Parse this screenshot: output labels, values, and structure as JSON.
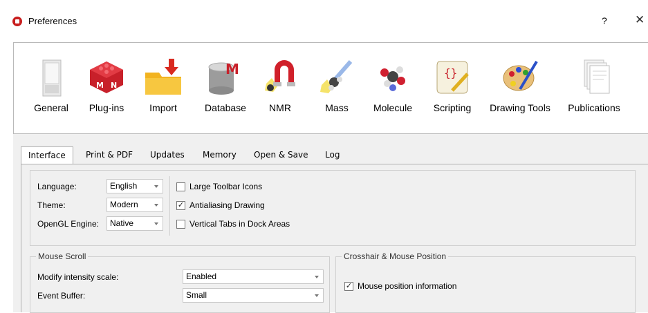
{
  "window": {
    "title": "Preferences",
    "help": "?",
    "close": "✕"
  },
  "toolbar": {
    "items": [
      {
        "label": "General",
        "icon": "general-icon"
      },
      {
        "label": "Plug-ins",
        "icon": "plugins-icon"
      },
      {
        "label": "Import",
        "icon": "import-icon"
      },
      {
        "label": "Database",
        "icon": "database-icon"
      },
      {
        "label": "NMR",
        "icon": "nmr-icon"
      },
      {
        "label": "Mass",
        "icon": "mass-icon"
      },
      {
        "label": "Molecule",
        "icon": "molecule-icon"
      },
      {
        "label": "Scripting",
        "icon": "scripting-icon"
      },
      {
        "label": "Drawing Tools",
        "icon": "drawing-tools-icon"
      },
      {
        "label": "Publications",
        "icon": "publications-icon"
      }
    ]
  },
  "tabs": [
    "Interface",
    "Print & PDF",
    "Updates",
    "Memory",
    "Open & Save",
    "Log"
  ],
  "active_tab": "Interface",
  "interface": {
    "language_label": "Language:",
    "language_value": "English",
    "theme_label": "Theme:",
    "theme_value": "Modern",
    "opengl_label": "OpenGL Engine:",
    "opengl_value": "Native",
    "large_icons_label": "Large Toolbar Icons",
    "large_icons_checked": false,
    "antialias_label": "Antialiasing Drawing",
    "antialias_checked": true,
    "vertical_tabs_label": "Vertical Tabs in Dock Areas",
    "vertical_tabs_checked": false
  },
  "mouse_scroll": {
    "title": "Mouse Scroll",
    "modify_label": "Modify intensity scale:",
    "modify_value": "Enabled",
    "buffer_label": "Event Buffer:",
    "buffer_value": "Small"
  },
  "crosshair": {
    "title": "Crosshair & Mouse Position",
    "mouse_info_label": "Mouse position information",
    "mouse_info_checked": true
  },
  "colors": {
    "brand": "#c81e1e",
    "panel_bg": "#f0f0f0"
  }
}
